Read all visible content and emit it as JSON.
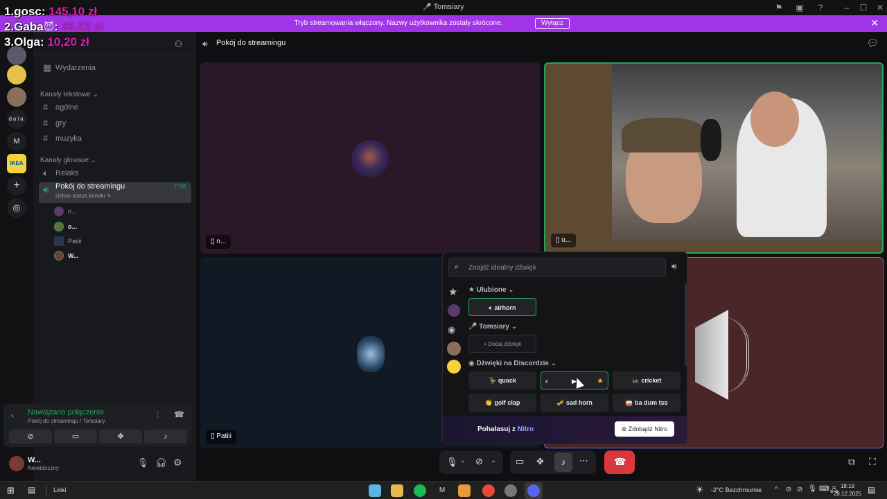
{
  "window": {
    "title": "Tomsiary"
  },
  "banner": {
    "message": "Tryb streamowania włączony. Nazwy użytkownika zostały skrócone.",
    "button": "Wyłącz"
  },
  "ranking": [
    {
      "name": "1.gosc:",
      "amount": "145,10 zł"
    },
    {
      "name": "2.Gaba",
      "amount": "33,52 zł"
    },
    {
      "name": "3.Olga:",
      "amount": "10,20 zł"
    }
  ],
  "rail": {
    "dala": "dala",
    "m": "M"
  },
  "channels": {
    "events": "Wydarzenia",
    "text_category": "Kanały tekstowe",
    "text": [
      "ogólne",
      "gry",
      "muzyka"
    ],
    "voice_category": "Kanały głosowe",
    "voice1": "Relaks",
    "voice2": "Pokój do streamingu",
    "voice2_time": "7:08",
    "voice2_status": "Ustaw status kanału",
    "users": [
      "n...",
      "o...",
      "Patiii",
      "W..."
    ]
  },
  "voice": {
    "status": "Nawiązano połączenie",
    "location": "Pokój do streamingu / Tomsiary"
  },
  "user": {
    "name": "W...",
    "status": "Niewidoczny"
  },
  "main": {
    "header": "Pokój do streamingu"
  },
  "tiles": {
    "t1": "n...",
    "t2": "o...",
    "t3": "Patiii"
  },
  "sounds": {
    "search_placeholder": "Znajdź idealny dźwięk",
    "fav_header": "Ulubione",
    "fav_sound": "airhorn",
    "server_header": "Tomsiary",
    "add_sound": "Dodaj dźwięk",
    "discord_header": "Dźwięki na Discordzie",
    "row1": [
      "quack",
      "cricket"
    ],
    "row2": [
      "golf clap",
      "sad horn",
      "ba dum tss"
    ],
    "nitro_text": "Pohałasuj z",
    "nitro_word": "Nitro",
    "nitro_button": "Zdobądź Nitro"
  },
  "taskbar": {
    "links": "Linki",
    "temp": "-2°C",
    "weather": "Bezchmurnie",
    "time": "18:19",
    "date": "28.12.2025"
  },
  "colors": {
    "banner": "#a134e8",
    "accent_green": "#23a55a",
    "end_call": "#da373c",
    "ranking_amount": "#d81fb0"
  }
}
